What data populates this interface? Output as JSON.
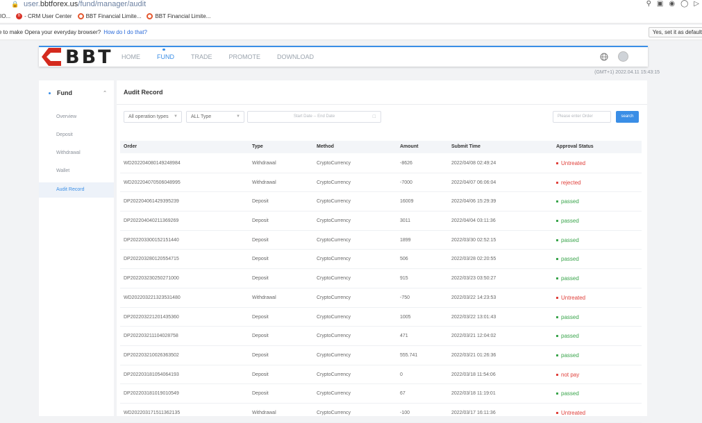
{
  "browser": {
    "url_prefix": "user.",
    "url_domain": "bbtforex.us",
    "url_path": "/fund/manager/audit",
    "bookmarks": [
      "IO...",
      "- CRM User Center",
      "BBT Financial Limite...",
      "BBT Financial Limite..."
    ],
    "opera_msg": "e to make Opera your everyday browser?",
    "opera_link": "How do I do that?",
    "opera_btn": "Yes, set it as default"
  },
  "header": {
    "logo_text": "BBT",
    "nav": [
      "HOME",
      "FUND",
      "TRADE",
      "PROMOTE",
      "DOWNLOAD"
    ],
    "active_nav": "FUND",
    "clock": "(GMT+1) 2022.04.11 15:43:15"
  },
  "sidebar": {
    "title": "Fund",
    "items": [
      "Overview",
      "Deposit",
      "Withdrawal",
      "Wallet",
      "Audit Record"
    ],
    "active": "Audit Record"
  },
  "main": {
    "title": "Audit Record",
    "filters": {
      "operation": "All operation types",
      "type": "ALL Type",
      "date_placeholder": "Start Date -- End Date",
      "order_placeholder": "Please enter Order",
      "search_label": "search"
    },
    "columns": [
      "Order",
      "Type",
      "Method",
      "Amount",
      "Submit Time",
      "Approval Status"
    ],
    "rows": [
      {
        "order": "WD202204080149248984",
        "type": "Withdrawal",
        "method": "CryptoCurrency",
        "amount": "-8626",
        "time": "2022/04/08 02:49:24",
        "status": "Untreated"
      },
      {
        "order": "WD202204070506048995",
        "type": "Withdrawal",
        "method": "CryptoCurrency",
        "amount": "-7000",
        "time": "2022/04/07 06:06:04",
        "status": "rejected"
      },
      {
        "order": "DP202204061429395239",
        "type": "Deposit",
        "method": "CryptoCurrency",
        "amount": "16009",
        "time": "2022/04/06 15:29:39",
        "status": "passed"
      },
      {
        "order": "DP202204040211369269",
        "type": "Deposit",
        "method": "CryptoCurrency",
        "amount": "3011",
        "time": "2022/04/04 03:11:36",
        "status": "passed"
      },
      {
        "order": "DP202203300152151440",
        "type": "Deposit",
        "method": "CryptoCurrency",
        "amount": "1899",
        "time": "2022/03/30 02:52:15",
        "status": "passed"
      },
      {
        "order": "DP202203280120554715",
        "type": "Deposit",
        "method": "CryptoCurrency",
        "amount": "506",
        "time": "2022/03/28 02:20:55",
        "status": "passed"
      },
      {
        "order": "DP202203230250271000",
        "type": "Deposit",
        "method": "CryptoCurrency",
        "amount": "915",
        "time": "2022/03/23 03:50:27",
        "status": "passed"
      },
      {
        "order": "WD202203221323531480",
        "type": "Withdrawal",
        "method": "CryptoCurrency",
        "amount": "-750",
        "time": "2022/03/22 14:23:53",
        "status": "Untreated"
      },
      {
        "order": "DP202203221201435360",
        "type": "Deposit",
        "method": "CryptoCurrency",
        "amount": "1005",
        "time": "2022/03/22 13:01:43",
        "status": "passed"
      },
      {
        "order": "DP202203211104028758",
        "type": "Deposit",
        "method": "CryptoCurrency",
        "amount": "471",
        "time": "2022/03/21 12:04:02",
        "status": "passed"
      },
      {
        "order": "DP202203210026363502",
        "type": "Deposit",
        "method": "CryptoCurrency",
        "amount": "555.741",
        "time": "2022/03/21 01:26:36",
        "status": "passed"
      },
      {
        "order": "DP202203181054064193",
        "type": "Deposit",
        "method": "CryptoCurrency",
        "amount": "0",
        "time": "2022/03/18 11:54:06",
        "status": "not pay"
      },
      {
        "order": "DP202203181019010549",
        "type": "Deposit",
        "method": "CryptoCurrency",
        "amount": "67",
        "time": "2022/03/18 11:19:01",
        "status": "passed"
      },
      {
        "order": "WD202203171511362135",
        "type": "Withdrawal",
        "method": "CryptoCurrency",
        "amount": "-100",
        "time": "2022/03/17 16:11:36",
        "status": "Untreated"
      }
    ]
  },
  "colors": {
    "accent": "#3a8ee6",
    "passed": "#3aa54c",
    "negative": "#e0403b",
    "logo_red": "#d42a1e"
  }
}
